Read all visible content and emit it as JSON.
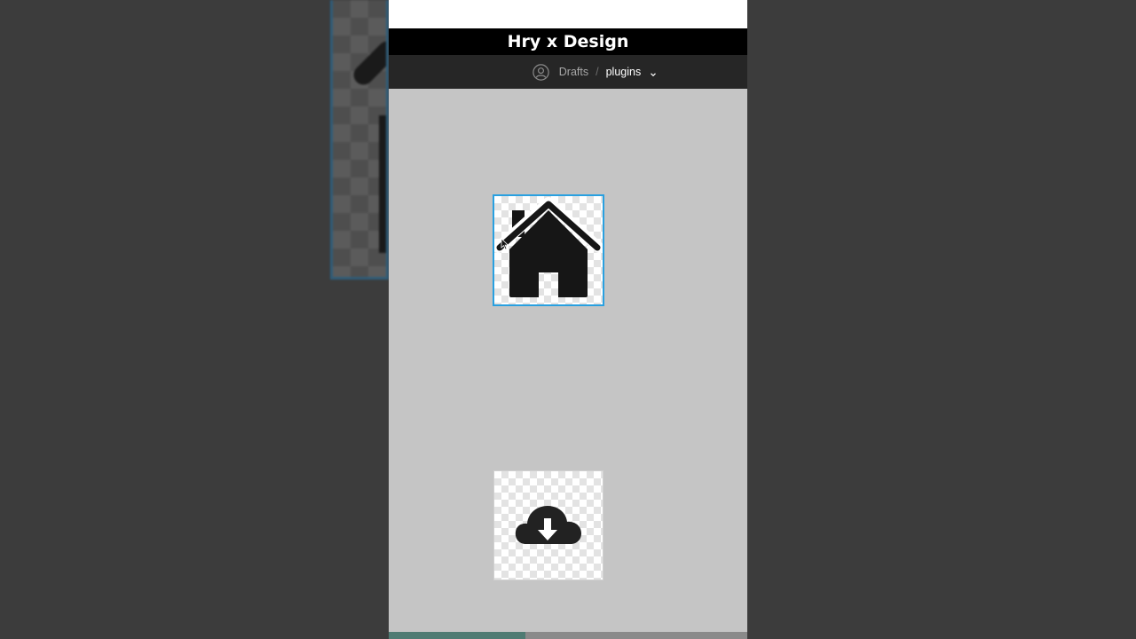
{
  "header": {
    "channel_title": "Hry x Design"
  },
  "breadcrumb": {
    "parent": "Drafts",
    "separator": "/",
    "current": "plugins"
  },
  "canvas": {
    "frames": [
      {
        "icon": "house-icon",
        "selected": true
      },
      {
        "icon": "cloud-download-icon",
        "selected": false
      }
    ]
  },
  "colors": {
    "selection": "#29a0e0",
    "canvas_bg": "#c5c5c5",
    "title_bar": "#000000",
    "nav_bar": "#262626",
    "progress": "#4f7b73"
  },
  "video_progress": 0.38
}
